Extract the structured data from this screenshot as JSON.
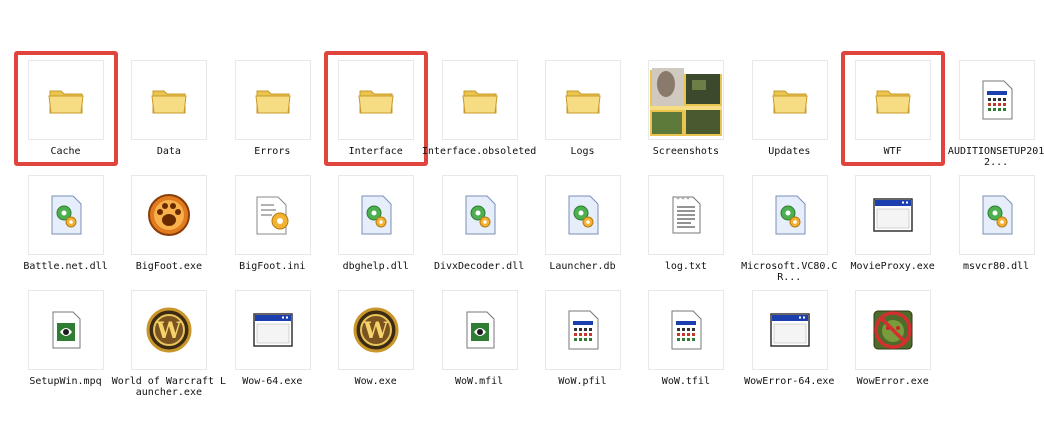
{
  "colors": {
    "highlight": "#e0453d",
    "folder": "#f3d575",
    "background": "#ffffff"
  },
  "rows": [
    [
      {
        "name": "Cache",
        "icon": "folder-icon",
        "highlighted": true
      },
      {
        "name": "Data",
        "icon": "folder-icon",
        "highlighted": false
      },
      {
        "name": "Errors",
        "icon": "folder-icon",
        "highlighted": false
      },
      {
        "name": "Interface",
        "icon": "folder-icon",
        "highlighted": true
      },
      {
        "name": "Interface.obsoleted",
        "icon": "folder-icon",
        "highlighted": false
      },
      {
        "name": "Logs",
        "icon": "folder-icon",
        "highlighted": false
      },
      {
        "name": "Screenshots",
        "icon": "image-folder-icon",
        "highlighted": false
      },
      {
        "name": "Updates",
        "icon": "folder-icon",
        "highlighted": false
      },
      {
        "name": "WTF",
        "icon": "folder-icon",
        "highlighted": true
      },
      {
        "name": "AUDITIONSETUP2012...",
        "icon": "app-window-icon",
        "highlighted": false
      }
    ],
    [
      {
        "name": "Battle.net.dll",
        "icon": "dll-gear-icon",
        "highlighted": false
      },
      {
        "name": "BigFoot.exe",
        "icon": "pawprint-icon",
        "highlighted": false
      },
      {
        "name": "BigFoot.ini",
        "icon": "settings-file-icon",
        "highlighted": false
      },
      {
        "name": "dbghelp.dll",
        "icon": "dll-gear-icon",
        "highlighted": false
      },
      {
        "name": "DivxDecoder.dll",
        "icon": "dll-gear-icon",
        "highlighted": false
      },
      {
        "name": "Launcher.db",
        "icon": "dll-gear-icon",
        "highlighted": false
      },
      {
        "name": "log.txt",
        "icon": "text-file-icon",
        "highlighted": false
      },
      {
        "name": "Microsoft.VC80.CR...",
        "icon": "dll-gear-icon",
        "highlighted": false
      },
      {
        "name": "MovieProxy.exe",
        "icon": "exe-window-icon",
        "highlighted": false
      },
      {
        "name": "msvcr80.dll",
        "icon": "dll-gear-icon",
        "highlighted": false
      }
    ],
    [
      {
        "name": "SetupWin.mpq",
        "icon": "media-file-icon",
        "highlighted": false
      },
      {
        "name": "World of Warcraft Launcher.exe",
        "icon": "wow-logo-icon",
        "highlighted": false
      },
      {
        "name": "Wow-64.exe",
        "icon": "exe-window-icon",
        "highlighted": false
      },
      {
        "name": "Wow.exe",
        "icon": "wow-logo-icon",
        "highlighted": false
      },
      {
        "name": "WoW.mfil",
        "icon": "media-file-icon",
        "highlighted": false
      },
      {
        "name": "WoW.pfil",
        "icon": "app-window-icon",
        "highlighted": false
      },
      {
        "name": "WoW.tfil",
        "icon": "app-window-icon",
        "highlighted": false
      },
      {
        "name": "WowError-64.exe",
        "icon": "exe-window-icon",
        "highlighted": false
      },
      {
        "name": "WowError.exe",
        "icon": "error-orc-icon",
        "highlighted": false
      }
    ]
  ]
}
